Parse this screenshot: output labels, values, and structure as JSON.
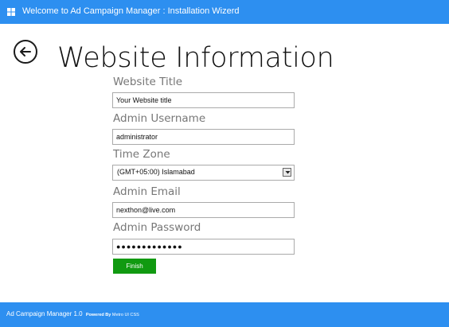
{
  "window": {
    "title": "Welcome to Ad Campaign Manager : Installation Wizerd"
  },
  "page": {
    "title": "Website Information"
  },
  "form": {
    "website_title": {
      "label": "Website Title",
      "value": "Your Website title"
    },
    "admin_username": {
      "label": "Admin Username",
      "value": "administrator"
    },
    "time_zone": {
      "label": "Time Zone",
      "selected": "(GMT+05:00) Islamabad"
    },
    "admin_email": {
      "label": "Admin Email",
      "value": "nexthon@live.com"
    },
    "admin_password": {
      "label": "Admin Password",
      "value": "●●●●●●●●●●●●●"
    },
    "finish_label": "Finish"
  },
  "footer": {
    "app_name": "Ad Campaign Manager 1.0",
    "powered_by_prefix": "Powered By",
    "powered_by_name": "Metro UI CSS"
  },
  "colors": {
    "header_bg": "#2d8ff0",
    "footer_bg": "#2d8ff0",
    "finish_bg": "#119a11"
  },
  "icons": {
    "logo": "windows-logo-icon",
    "back": "back-arrow-icon",
    "dropdown": "chevron-down-icon"
  }
}
